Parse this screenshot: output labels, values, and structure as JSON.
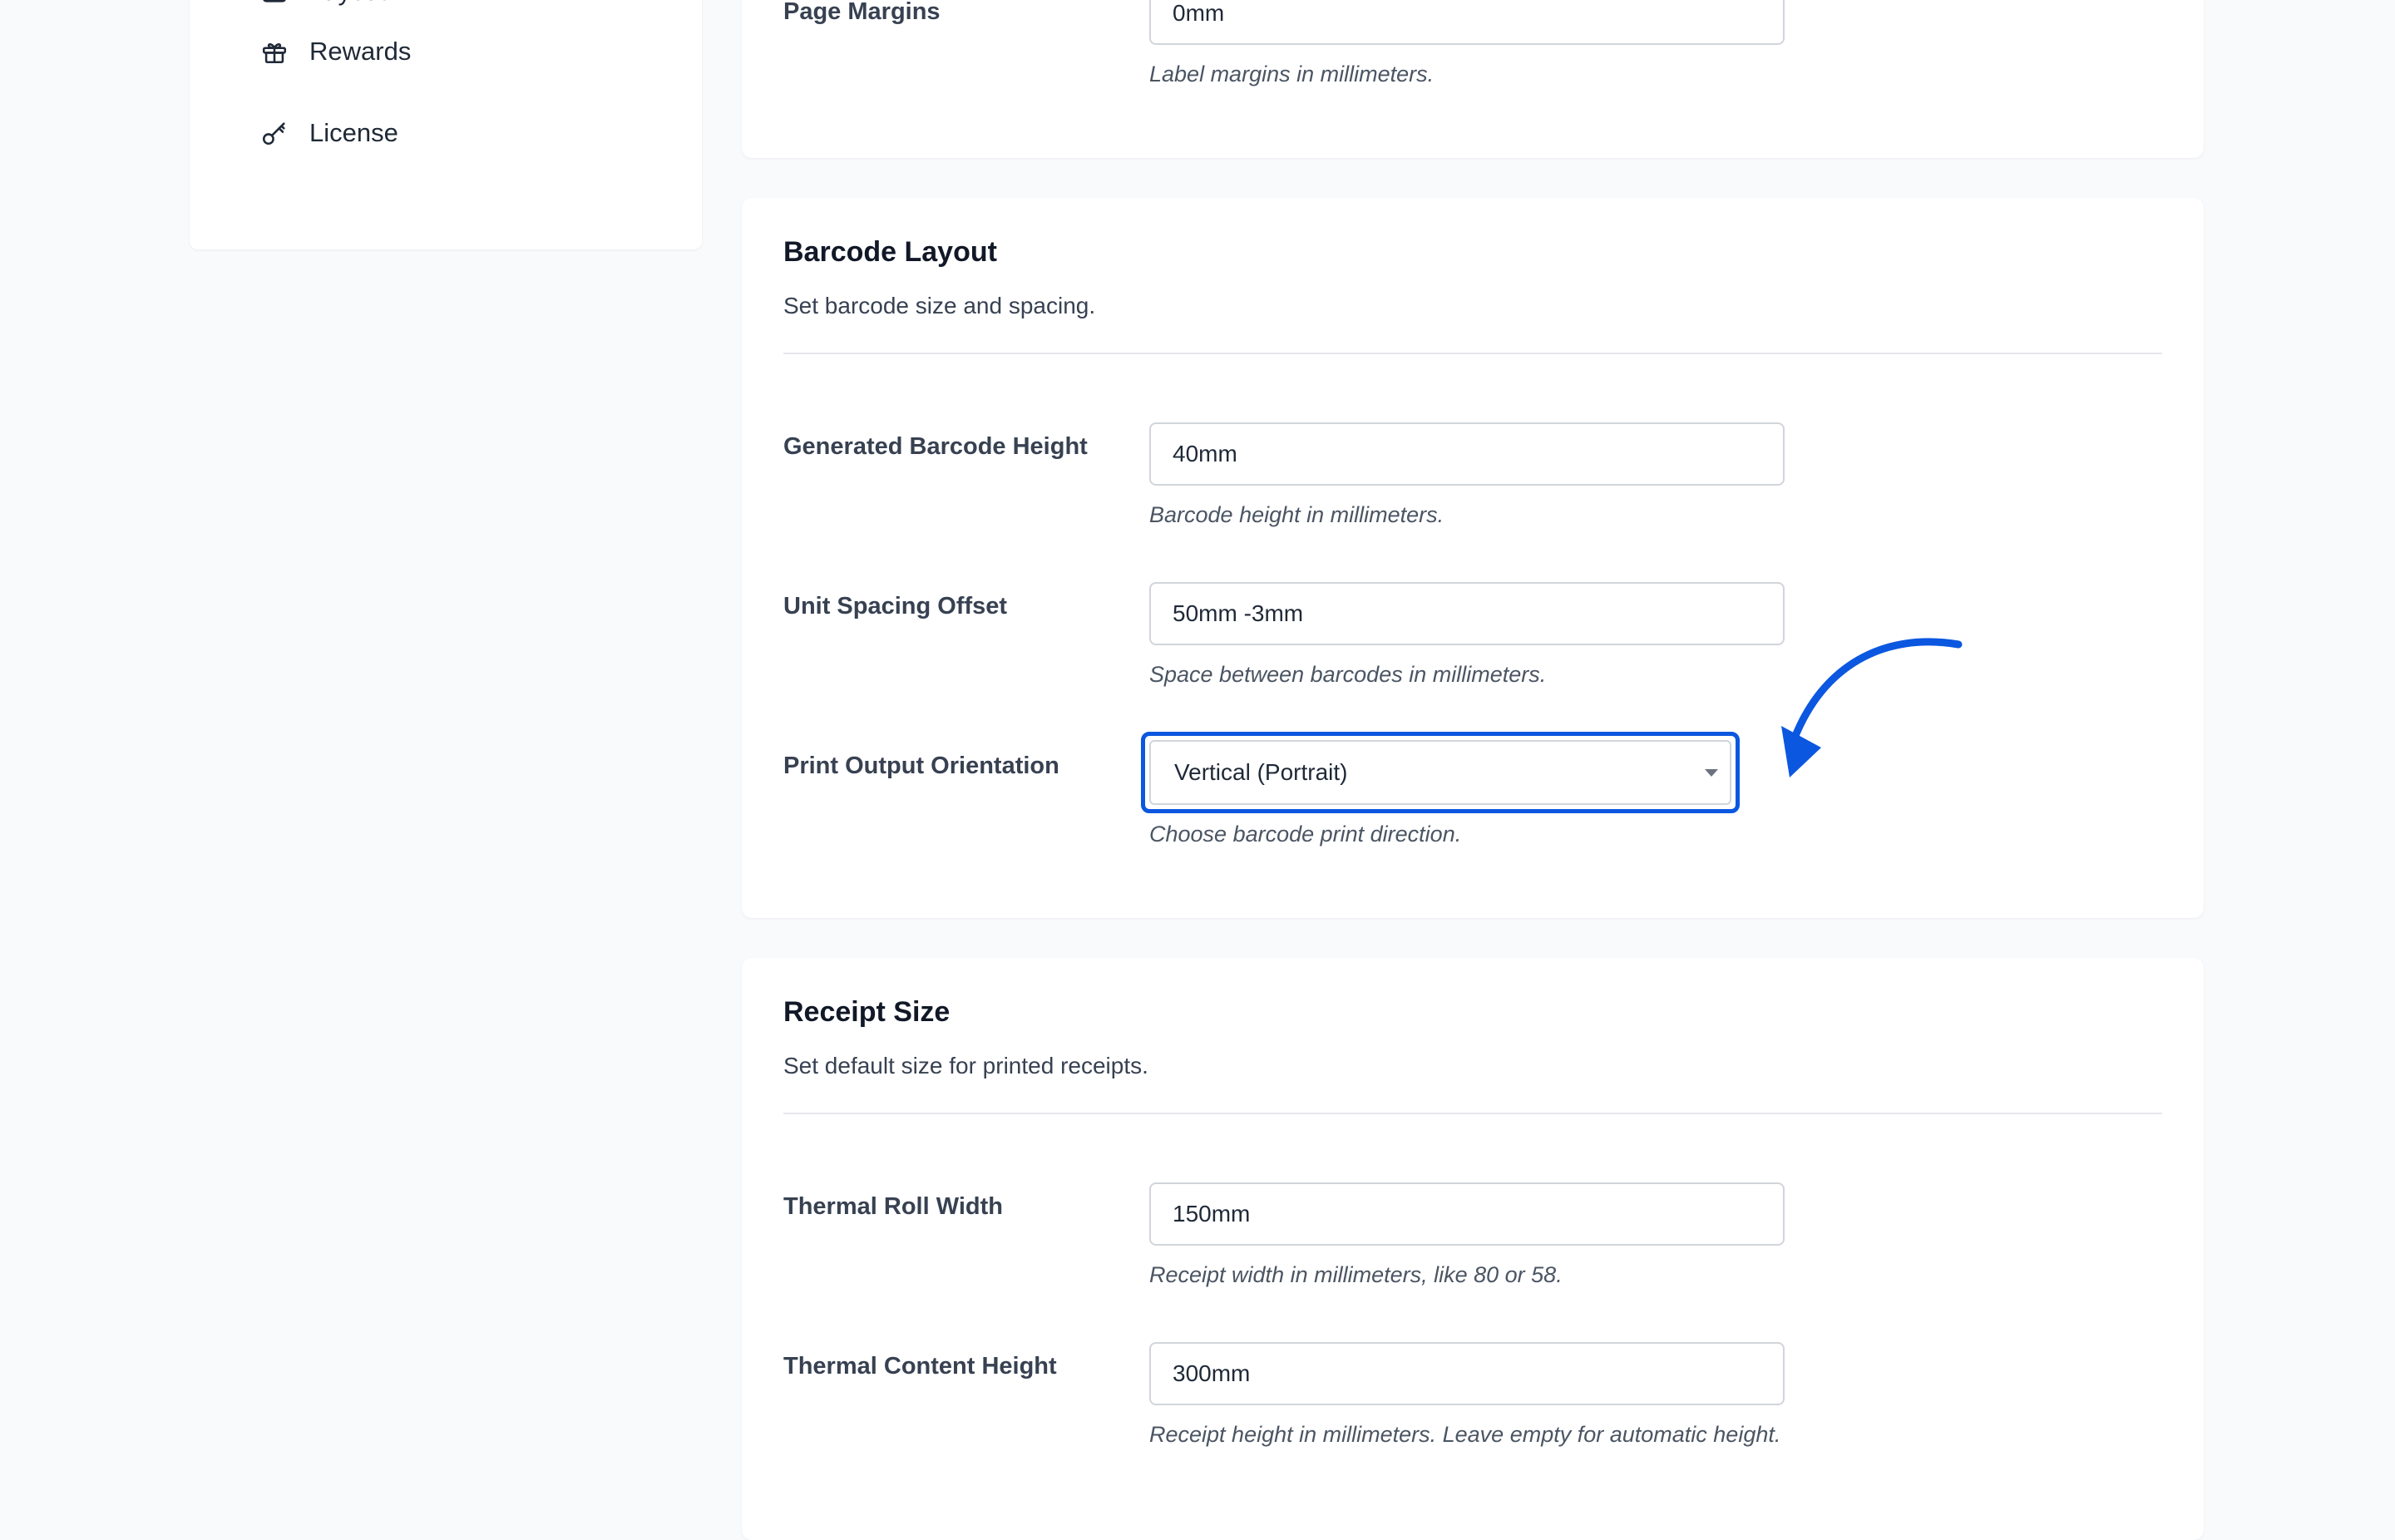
{
  "sidebar": {
    "items": [
      {
        "label": "Layout",
        "icon": "layout-icon"
      },
      {
        "label": "Rewards",
        "icon": "gift-icon"
      },
      {
        "label": "License",
        "icon": "key-icon"
      }
    ]
  },
  "page_margins_card": {
    "field_label": "Page Margins",
    "value": "0mm",
    "help": "Label margins in millimeters."
  },
  "barcode_layout": {
    "title": "Barcode Layout",
    "subtitle": "Set barcode size and spacing.",
    "height_label": "Generated Barcode Height",
    "height_value": "40mm",
    "height_help": "Barcode height in millimeters.",
    "spacing_label": "Unit Spacing Offset",
    "spacing_value": "50mm -3mm",
    "spacing_help": "Space between barcodes in millimeters.",
    "orientation_label": "Print Output Orientation",
    "orientation_value": "Vertical (Portrait)",
    "orientation_help": "Choose barcode print direction."
  },
  "receipt_size": {
    "title": "Receipt Size",
    "subtitle": "Set default size for printed receipts.",
    "width_label": "Thermal Roll Width",
    "width_value": "150mm",
    "width_help": "Receipt width in millimeters, like 80 or 58.",
    "height_label": "Thermal Content Height",
    "height_value": "300mm",
    "height_help": "Receipt height in millimeters. Leave empty for automatic height."
  },
  "colors": {
    "accent": "#0b57e0",
    "background": "#f8fafc",
    "card": "#ffffff"
  }
}
